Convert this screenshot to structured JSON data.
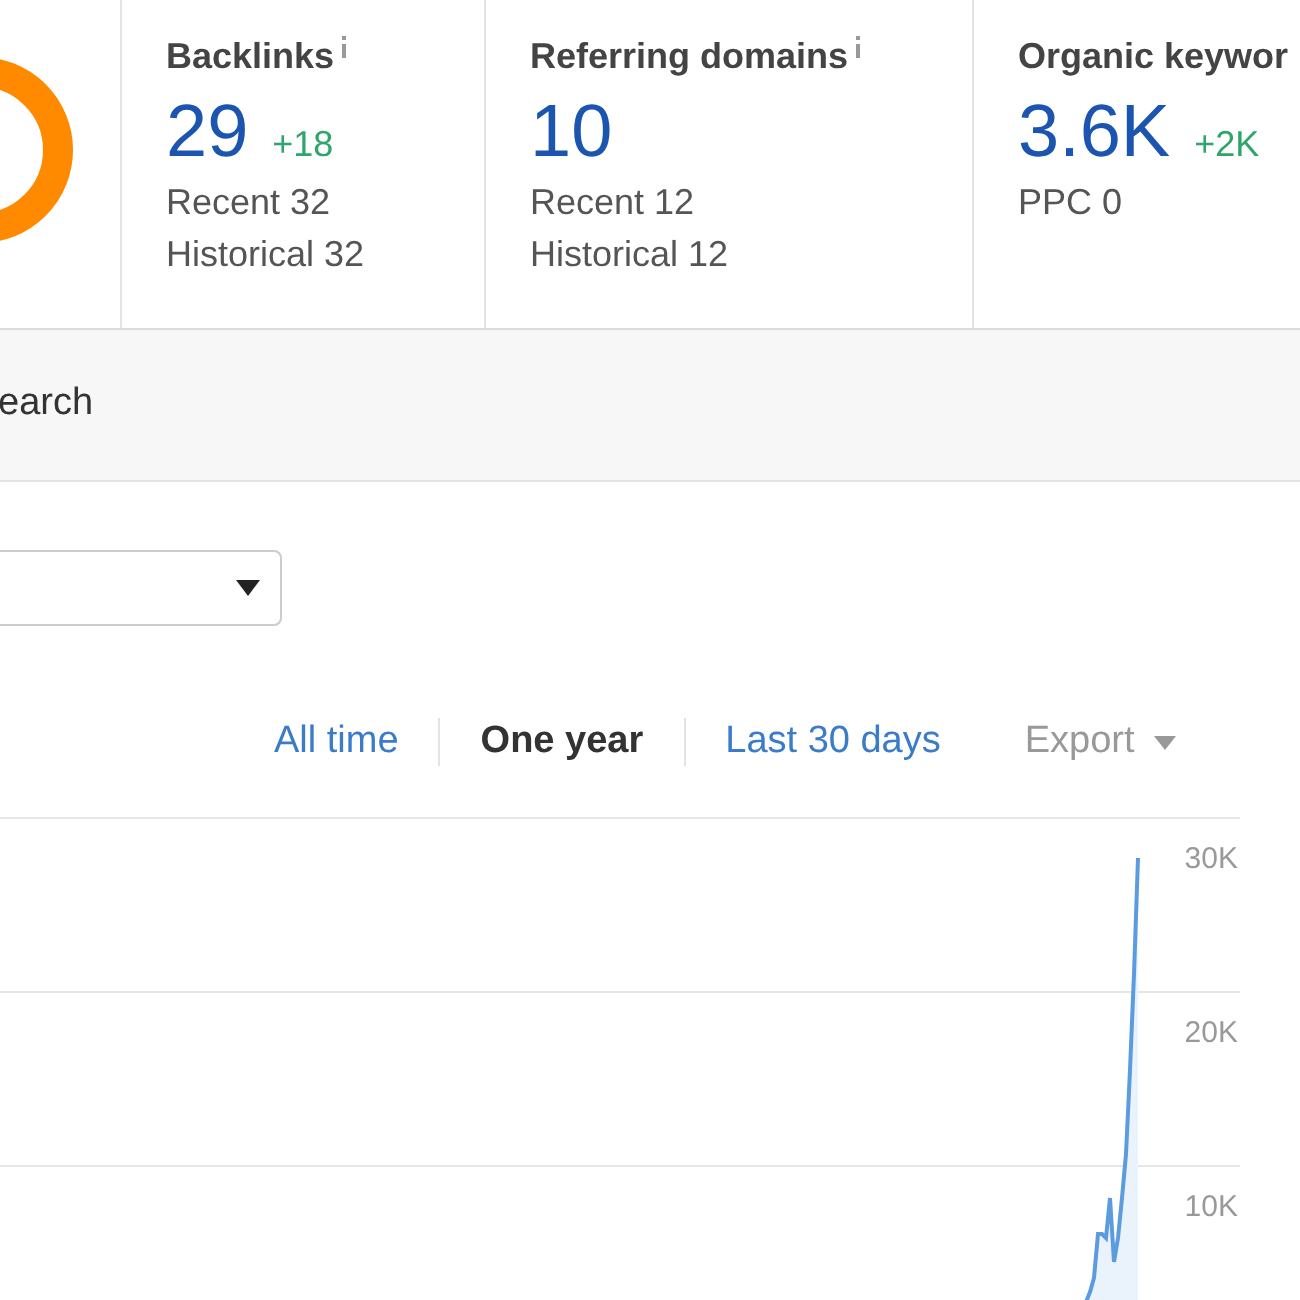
{
  "stats": [
    {
      "title": "Backlinks",
      "value": "29",
      "delta": "+18",
      "details": [
        "Recent 32",
        "Historical 32"
      ]
    },
    {
      "title": "Referring domains",
      "value": "10",
      "details": [
        "Recent 12",
        "Historical 12"
      ]
    },
    {
      "title": "Organic keywor",
      "value": "3.6K",
      "delta": "+2K",
      "details": [
        "PPC 0"
      ]
    }
  ],
  "section_tab": "earch",
  "period_tabs": [
    {
      "label": "All time",
      "selected": false
    },
    {
      "label": "One year",
      "selected": true
    },
    {
      "label": "Last 30 days",
      "selected": false
    }
  ],
  "export": "Export",
  "graph": {
    "axis_labels": [
      "30K",
      "20K",
      "10K"
    ]
  }
}
